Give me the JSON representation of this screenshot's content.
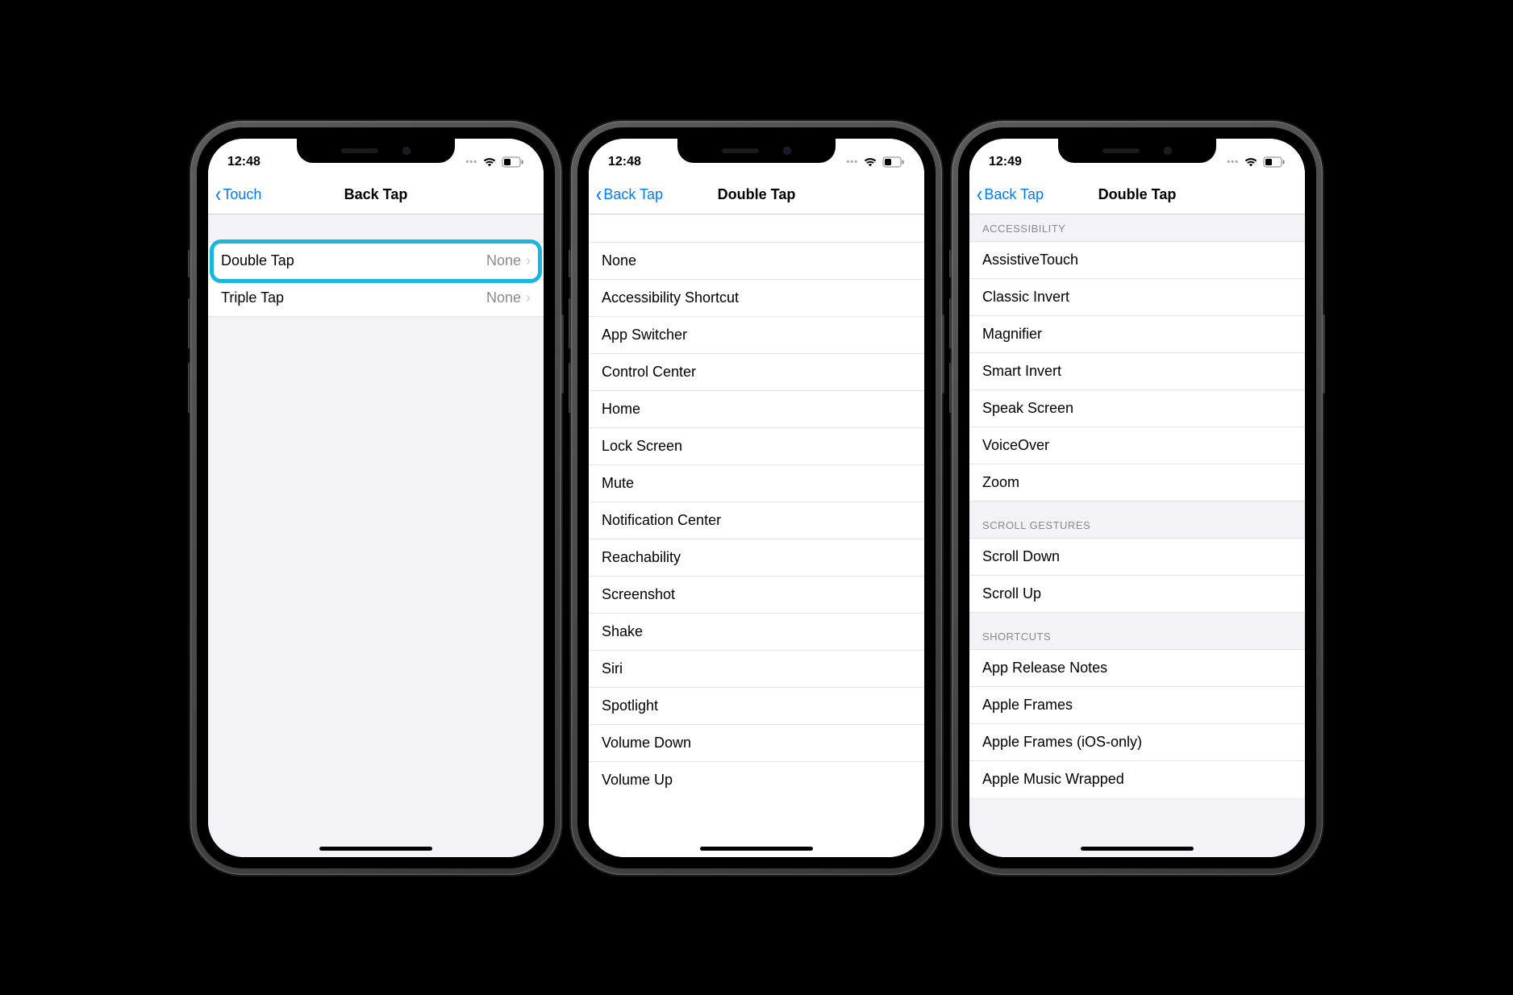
{
  "phones": [
    {
      "status": {
        "time": "12:48"
      },
      "nav": {
        "back": "Touch",
        "title": "Back Tap"
      },
      "rows": [
        {
          "label": "Double Tap",
          "value": "None",
          "highlight": true
        },
        {
          "label": "Triple Tap",
          "value": "None",
          "highlight": false
        }
      ]
    },
    {
      "status": {
        "time": "12:48"
      },
      "nav": {
        "back": "Back Tap",
        "title": "Double Tap"
      },
      "options": [
        "None",
        "Accessibility Shortcut",
        "App Switcher",
        "Control Center",
        "Home",
        "Lock Screen",
        "Mute",
        "Notification Center",
        "Reachability",
        "Screenshot",
        "Shake",
        "Siri",
        "Spotlight",
        "Volume Down",
        "Volume Up"
      ]
    },
    {
      "status": {
        "time": "12:49"
      },
      "nav": {
        "back": "Back Tap",
        "title": "Double Tap"
      },
      "sections": [
        {
          "header": "ACCESSIBILITY",
          "items": [
            "AssistiveTouch",
            "Classic Invert",
            "Magnifier",
            "Smart Invert",
            "Speak Screen",
            "VoiceOver",
            "Zoom"
          ]
        },
        {
          "header": "SCROLL GESTURES",
          "items": [
            "Scroll Down",
            "Scroll Up"
          ]
        },
        {
          "header": "SHORTCUTS",
          "items": [
            "App Release Notes",
            "Apple Frames",
            "Apple Frames (iOS-only)",
            "Apple Music Wrapped"
          ]
        }
      ]
    }
  ]
}
